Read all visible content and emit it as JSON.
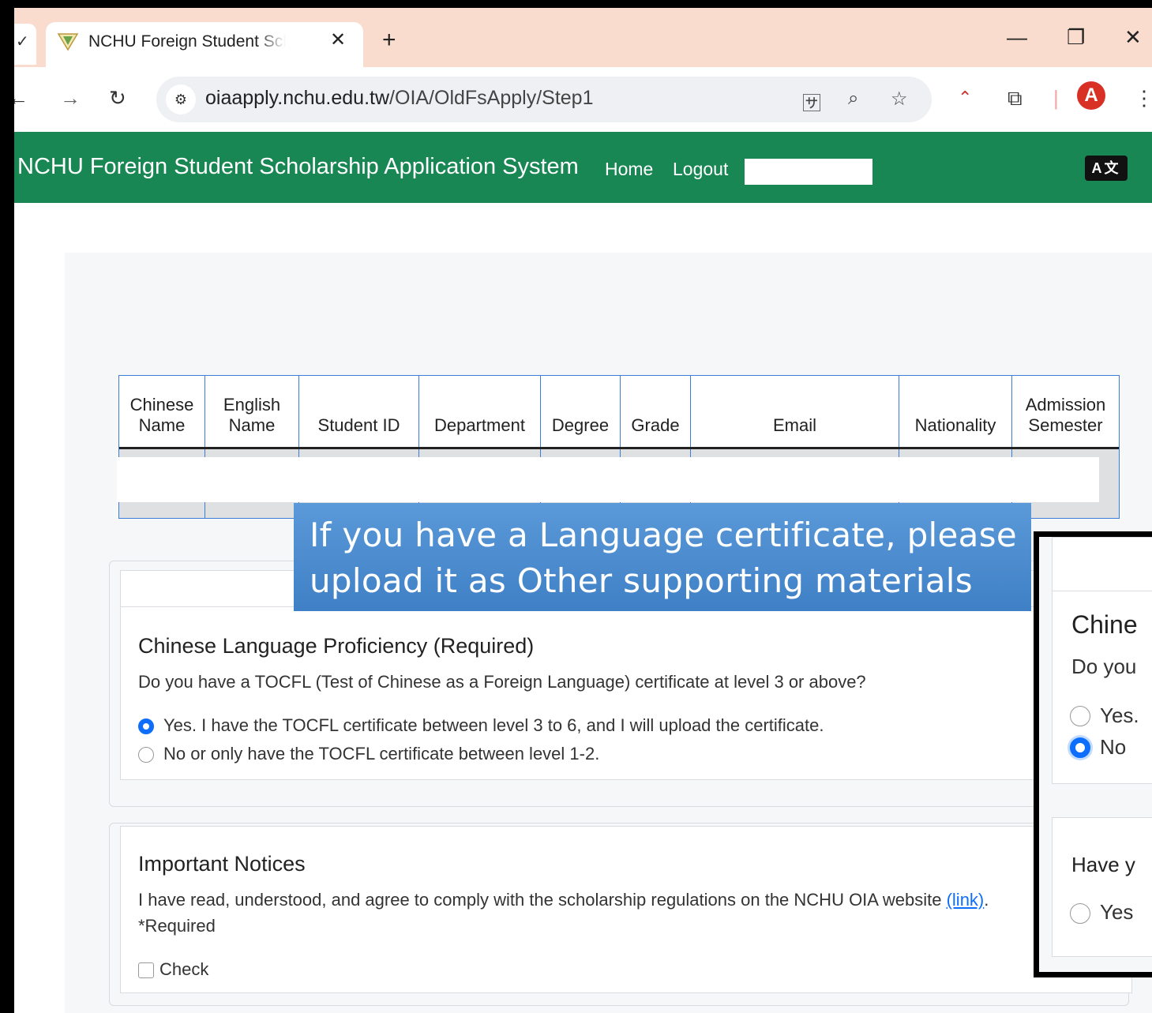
{
  "browser": {
    "tab_title": "NCHU Foreign Student Scholarship Application System",
    "tab_close": "✕",
    "new_tab": "+",
    "url_domain": "oiaapply.nchu.edu.tw",
    "url_path": "/OIA/OldFsApply/Step1",
    "window_controls": {
      "minimize": "—",
      "restore": "❐",
      "close": "✕"
    },
    "icons": [
      "back-arrow-icon",
      "forward-arrow-icon",
      "reload-icon",
      "site-info-icon",
      "translate-icon",
      "zoom-icon",
      "bookmark-star-icon",
      "extension-icon",
      "puzzle-icon",
      "profile-avatar-icon",
      "kebab-menu-icon"
    ]
  },
  "header": {
    "brand": "NCHU Foreign Student Scholarship Application System",
    "nav": {
      "home": "Home",
      "logout": "Logout"
    },
    "lang_toggle": "A文",
    "accent_color": "#198754"
  },
  "table": {
    "headers": [
      [
        "Chinese",
        "Name"
      ],
      [
        "English",
        "Name"
      ],
      [
        "",
        "Student ID"
      ],
      [
        "",
        "Department"
      ],
      [
        "",
        "Degree"
      ],
      [
        "",
        "Grade"
      ],
      [
        "",
        "Email"
      ],
      [
        "",
        "Nationality"
      ],
      [
        "Admission",
        "Semester"
      ]
    ]
  },
  "callout": {
    "line1": "If you have a Language certificate, please",
    "line2": "upload it as Other supporting materials",
    "color": "#4a8ccf"
  },
  "language_section": {
    "title": "Chinese Language Proficiency (Required)",
    "question": "Do you have a TOCFL (Test of Chinese as a Foreign Language) certificate at level 3 or above?",
    "options": [
      {
        "label": "Yes. I have the TOCFL certificate between level 3 to 6, and I will upload the certificate.",
        "selected": true
      },
      {
        "label": "No or only have the TOCFL certificate between level 1-2.",
        "selected": false
      }
    ]
  },
  "notices_section": {
    "title": "Important Notices",
    "text": "I have read, understood, and agree to comply with the scholarship regulations on the NCHU OIA website",
    "link": "(link)",
    "after_link": ".",
    "required": "*Required",
    "check_label": "Check",
    "checked": false
  },
  "inset": {
    "title": "Chine",
    "question": "Do you",
    "option_yes": "Yes.",
    "option_no": "No",
    "selected": "no",
    "next_title": "Have y",
    "next_option": "Yes"
  }
}
